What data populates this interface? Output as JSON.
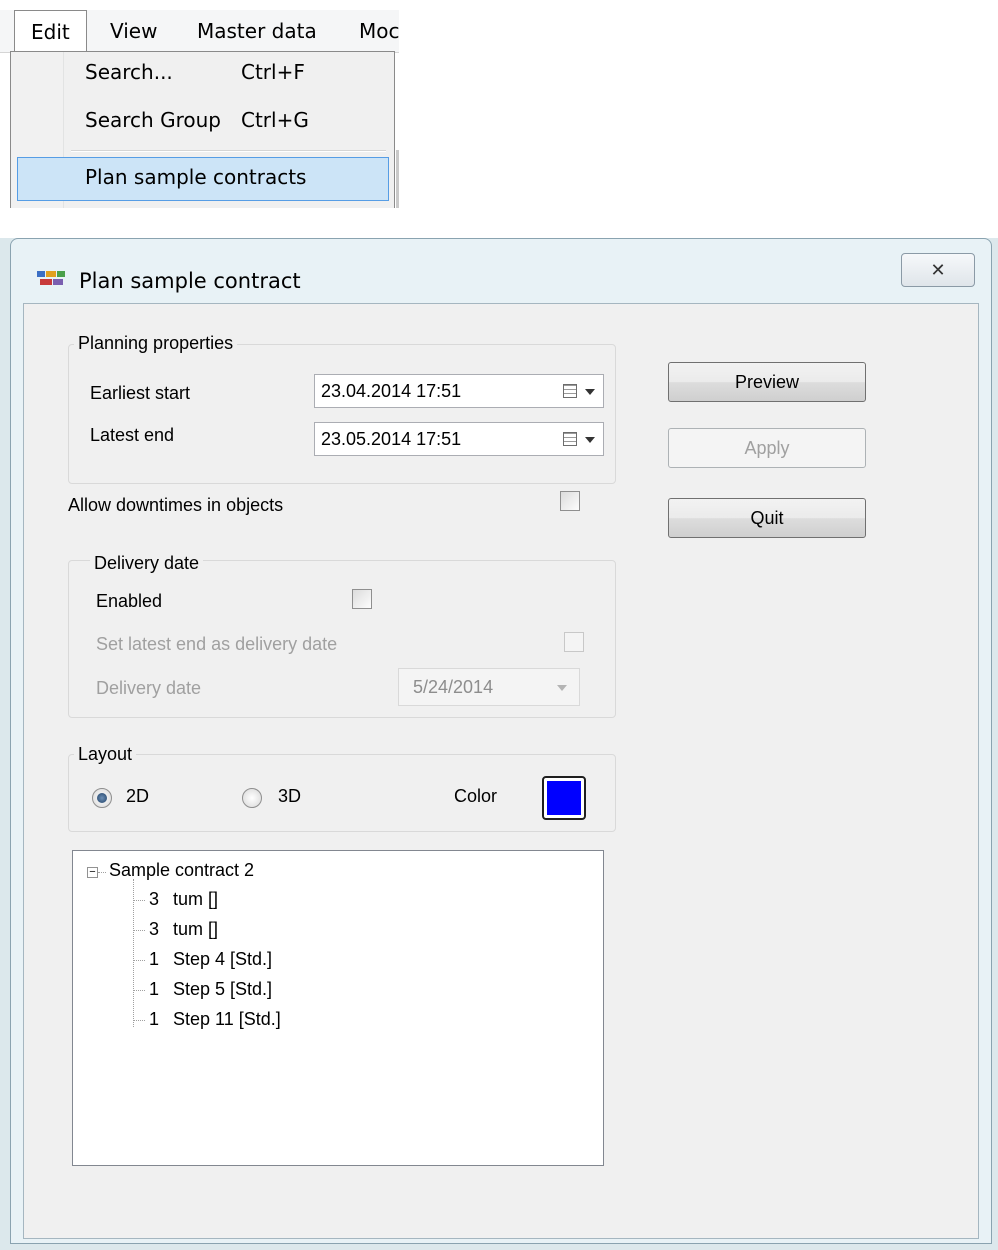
{
  "menu": {
    "bar_items": [
      "Edit",
      "View",
      "Master data",
      "Moc"
    ],
    "dropdown": {
      "items": [
        {
          "label": "Search...",
          "shortcut": "Ctrl+F"
        },
        {
          "label": "Search Group",
          "shortcut": "Ctrl+G"
        },
        {
          "label": "Plan sample contracts",
          "shortcut": ""
        }
      ]
    }
  },
  "dialog": {
    "title": "Plan sample contract",
    "close_glyph": "✕",
    "planning": {
      "title": "Planning properties",
      "earliest_start_label": "Earliest start",
      "earliest_start_value": "23.04.2014 17:51",
      "latest_end_label": "Latest end",
      "latest_end_value": "23.05.2014 17:51"
    },
    "allow_downtimes_label": "Allow downtimes in objects",
    "delivery": {
      "title": "Delivery date",
      "enabled_label": "Enabled",
      "set_latest_label": "Set latest end as delivery date",
      "delivery_date_label": "Delivery date",
      "delivery_date_value": "5/24/2014"
    },
    "layout": {
      "title": "Layout",
      "option_2d": "2D",
      "option_3d": "3D",
      "selected": "2D",
      "color_label": "Color",
      "color_value": "#0000ff"
    },
    "buttons": {
      "preview": "Preview",
      "apply": "Apply",
      "quit": "Quit"
    },
    "tree": {
      "root": "Sample contract 2",
      "children": [
        {
          "qty": "3",
          "label": "tum []"
        },
        {
          "qty": "3",
          "label": "tum []"
        },
        {
          "qty": "1",
          "label": "Step 4 [Std.]"
        },
        {
          "qty": "1",
          "label": "Step 5 [Std.]"
        },
        {
          "qty": "1",
          "label": "Step 11 [Std.]"
        }
      ]
    }
  }
}
